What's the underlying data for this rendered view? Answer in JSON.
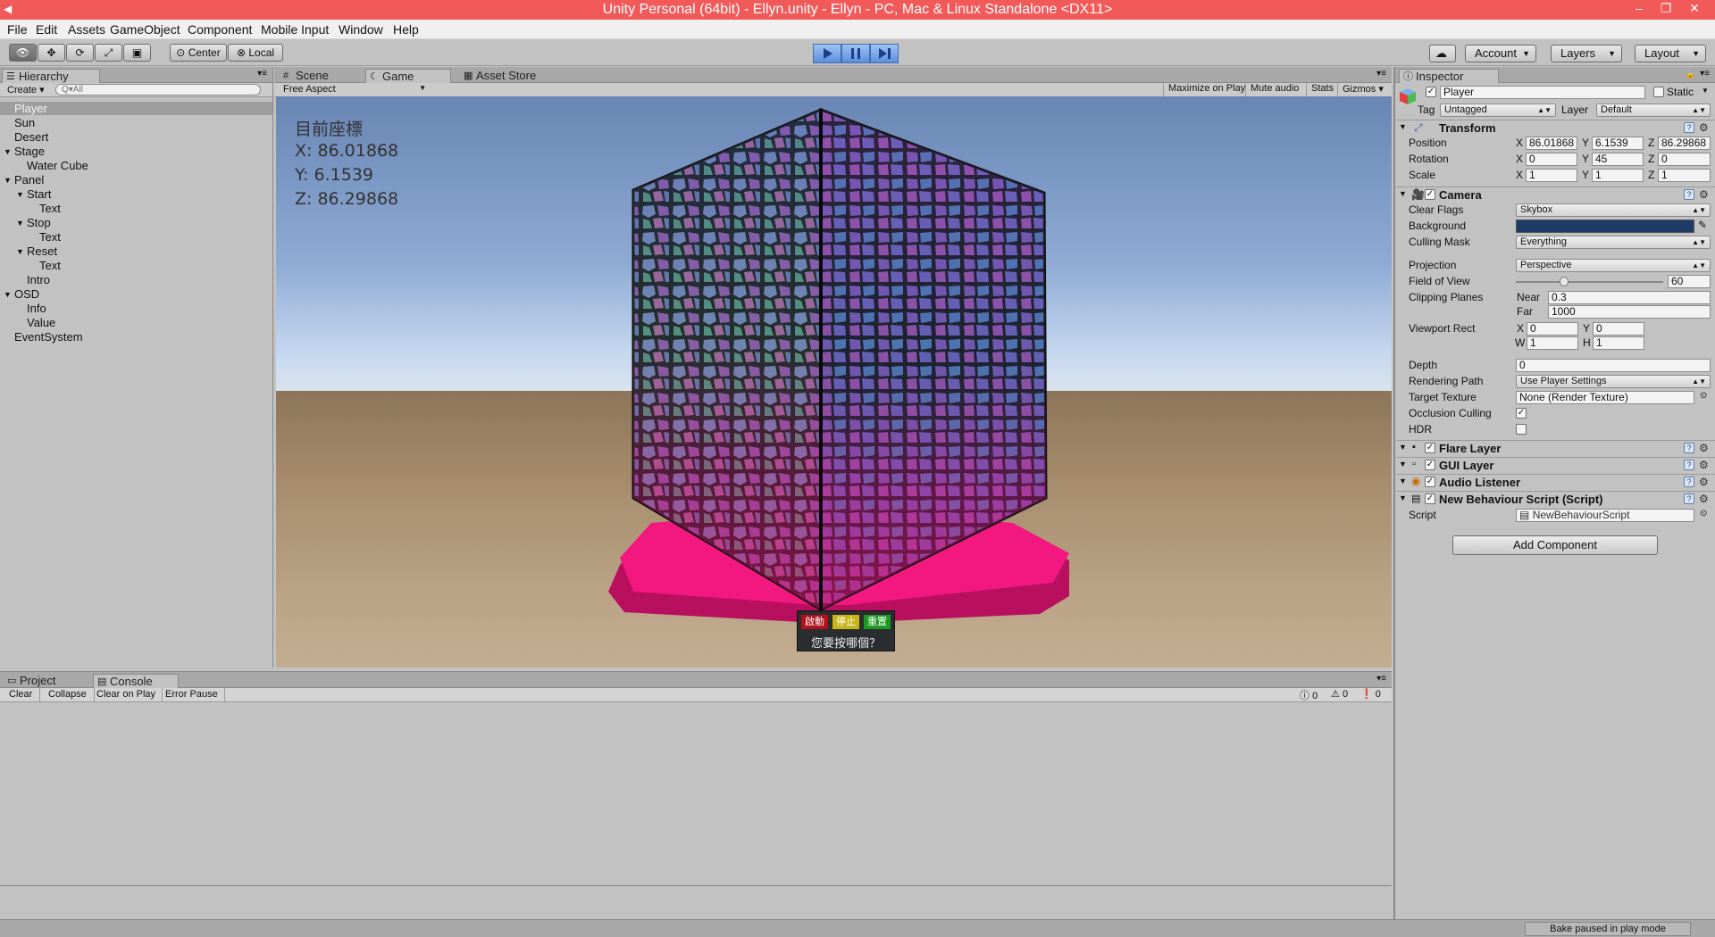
{
  "titlebar": {
    "title": "Unity Personal (64bit) - Ellyn.unity - Ellyn - PC, Mac & Linux Standalone <DX11>"
  },
  "menu": [
    "File",
    "Edit",
    "Assets",
    "GameObject",
    "Component",
    "Mobile Input",
    "Window",
    "Help"
  ],
  "toolbar": {
    "pivot": "Center",
    "space": "Local",
    "account": "Account",
    "layers": "Layers",
    "layout": "Layout"
  },
  "hierarchy": {
    "tab": "Hierarchy",
    "create": "Create",
    "search_placeholder": "Q▾All",
    "items": [
      {
        "label": "Player",
        "depth": 0,
        "selected": true
      },
      {
        "label": "Sun",
        "depth": 0
      },
      {
        "label": "Desert",
        "depth": 0
      },
      {
        "label": "Stage",
        "depth": 0,
        "expanded": true
      },
      {
        "label": "Water Cube",
        "depth": 1
      },
      {
        "label": "Panel",
        "depth": 0,
        "expanded": true
      },
      {
        "label": "Start",
        "depth": 1,
        "expanded": true
      },
      {
        "label": "Text",
        "depth": 2
      },
      {
        "label": "Stop",
        "depth": 1,
        "expanded": true
      },
      {
        "label": "Text",
        "depth": 2
      },
      {
        "label": "Reset",
        "depth": 1,
        "expanded": true
      },
      {
        "label": "Text",
        "depth": 2
      },
      {
        "label": "Intro",
        "depth": 1
      },
      {
        "label": "OSD",
        "depth": 0,
        "expanded": true
      },
      {
        "label": "Info",
        "depth": 1
      },
      {
        "label": "Value",
        "depth": 1
      },
      {
        "label": "EventSystem",
        "depth": 0
      }
    ]
  },
  "center_tabs": {
    "scene": "Scene",
    "game": "Game",
    "asset_store": "Asset Store"
  },
  "game_bar": {
    "aspect": "Free Aspect",
    "maximize": "Maximize on Play",
    "mute": "Mute audio",
    "stats": "Stats",
    "gizmos": "Gizmos"
  },
  "osd": {
    "title": "目前座標",
    "x": "X:  86.01868",
    "y": "Y:  6.1539",
    "z": "Z:  86.29868"
  },
  "panel_buttons": {
    "start": "啟動",
    "stop": "停止",
    "reset": "重置",
    "question": "您要按哪個？"
  },
  "bottom": {
    "project_tab": "Project",
    "console_tab": "Console",
    "clear": "Clear",
    "collapse": "Collapse",
    "clear_on_play": "Clear on Play",
    "error_pause": "Error Pause",
    "count_info": "0",
    "count_warn": "0",
    "count_error": "0"
  },
  "inspector": {
    "tab": "Inspector",
    "object_name": "Player",
    "static_label": "Static",
    "tag_label": "Tag",
    "tag_value": "Untagged",
    "layer_label": "Layer",
    "layer_value": "Default",
    "transform": {
      "title": "Transform",
      "position_label": "Position",
      "rotation_label": "Rotation",
      "scale_label": "Scale",
      "position": {
        "x": "86.01868",
        "y": "6.1539",
        "z": "86.29868"
      },
      "rotation": {
        "x": "0",
        "y": "45",
        "z": "0"
      },
      "scale": {
        "x": "1",
        "y": "1",
        "z": "1"
      }
    },
    "camera": {
      "title": "Camera",
      "clear_flags_label": "Clear Flags",
      "clear_flags": "Skybox",
      "background_label": "Background",
      "culling_label": "Culling Mask",
      "culling": "Everything",
      "projection_label": "Projection",
      "projection": "Perspective",
      "fov_label": "Field of View",
      "fov": "60",
      "clipping_label": "Clipping Planes",
      "near_label": "Near",
      "near": "0.3",
      "far_label": "Far",
      "far": "1000",
      "viewport_label": "Viewport Rect",
      "vp_x": "0",
      "vp_y": "0",
      "vp_w": "1",
      "vp_h": "1",
      "depth_label": "Depth",
      "depth": "0",
      "rendering_label": "Rendering Path",
      "rendering": "Use Player Settings",
      "target_label": "Target Texture",
      "target": "None (Render Texture)",
      "occlusion_label": "Occlusion Culling",
      "hdr_label": "HDR"
    },
    "components": [
      "Flare Layer",
      "GUI Layer",
      "Audio Listener",
      "New Behaviour Script (Script)"
    ],
    "script_label": "Script",
    "script_value": "NewBehaviourScript",
    "add_component": "Add Component"
  },
  "status": {
    "bake": "Bake paused in play mode"
  },
  "colors": {
    "titlebar": "#f25a5a",
    "play_blue": "#5c8ede",
    "background_swatch": "#1f3a66",
    "platform_pink": "#f21880"
  }
}
